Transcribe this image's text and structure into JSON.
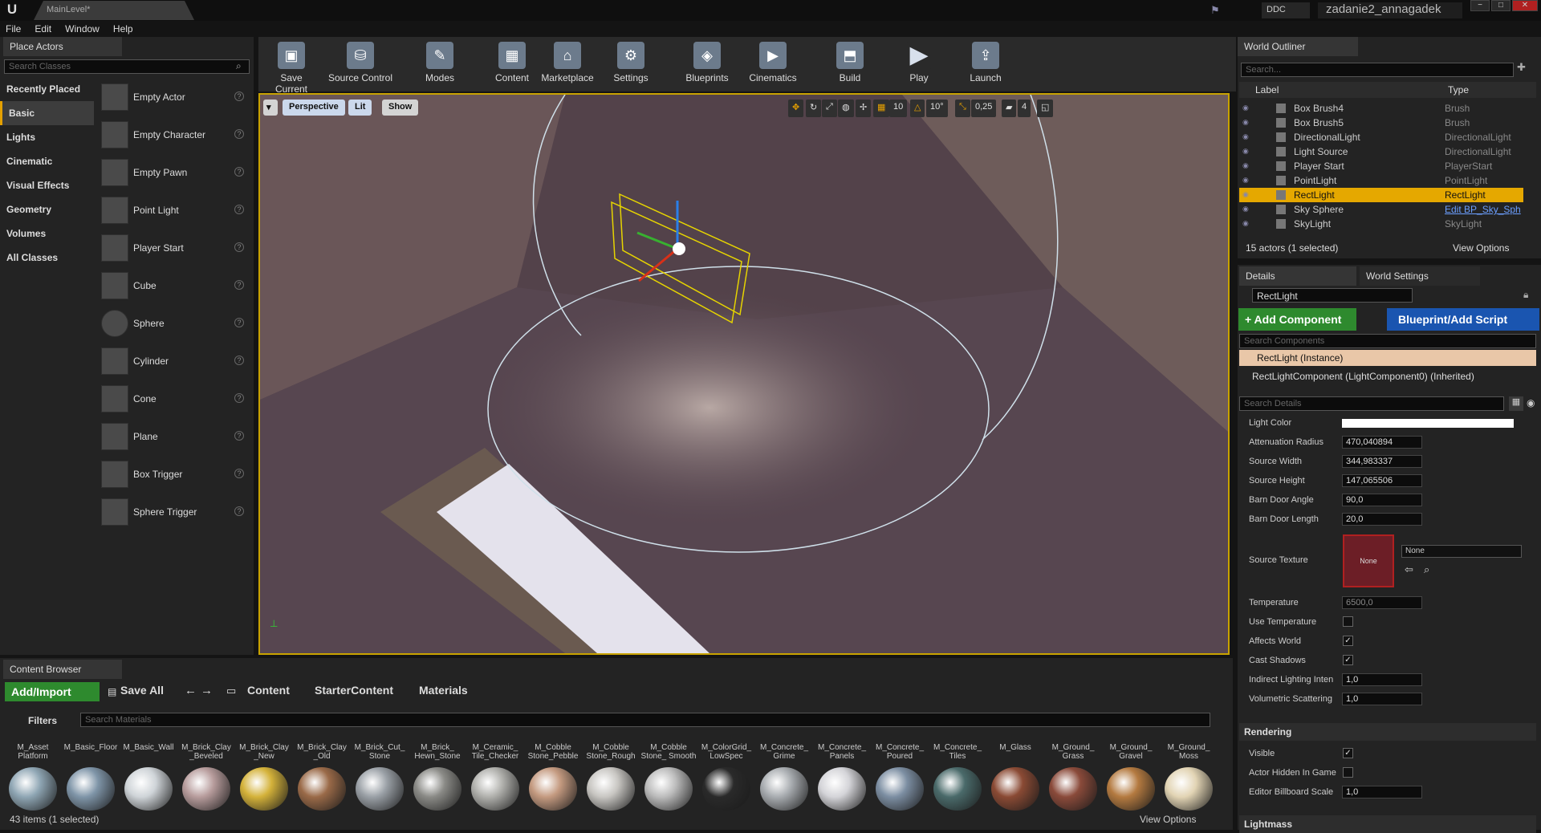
{
  "titlebar": {
    "logo": "U",
    "tab": "MainLevel*",
    "ddc": "DDC",
    "project": "zadanie2_annagadek",
    "min": "−",
    "max": "□",
    "close": "✕"
  },
  "menu": [
    "File",
    "Edit",
    "Window",
    "Help"
  ],
  "place_actors": {
    "tab": "Place Actors",
    "search_placeholder": "Search Classes",
    "categories": [
      "Recently Placed",
      "Basic",
      "Lights",
      "Cinematic",
      "Visual Effects",
      "Geometry",
      "Volumes",
      "All Classes"
    ],
    "selected_category": "Basic",
    "actors": [
      "Empty Actor",
      "Empty Character",
      "Empty Pawn",
      "Point Light",
      "Player Start",
      "Cube",
      "Sphere",
      "Cylinder",
      "Cone",
      "Plane",
      "Box Trigger",
      "Sphere Trigger"
    ]
  },
  "toolbar": {
    "buttons": [
      "Save Current",
      "Source Control",
      "Modes",
      "Content",
      "Marketplace",
      "Settings",
      "Blueprints",
      "Cinematics",
      "Build",
      "Play",
      "Launch"
    ],
    "icons": [
      "save-icon",
      "source-control-icon",
      "modes-icon",
      "content-icon",
      "marketplace-icon",
      "settings-icon",
      "blueprints-icon",
      "cinematics-icon",
      "build-icon",
      "play-icon",
      "launch-icon"
    ]
  },
  "viewport": {
    "perspective": "Perspective",
    "lit": "Lit",
    "show": "Show",
    "grid_snap": "10",
    "rot_snap": "10°",
    "scale_snap": "0,25",
    "cam_speed": "4"
  },
  "outliner": {
    "tab": "World Outliner",
    "search_placeholder": "Search...",
    "col_label": "Label",
    "col_type": "Type",
    "rows": [
      {
        "label": "Box Brush4",
        "type": "Brush"
      },
      {
        "label": "Box Brush5",
        "type": "Brush"
      },
      {
        "label": "DirectionalLight",
        "type": "DirectionalLight"
      },
      {
        "label": "Light Source",
        "type": "DirectionalLight"
      },
      {
        "label": "Player Start",
        "type": "PlayerStart"
      },
      {
        "label": "PointLight",
        "type": "PointLight"
      },
      {
        "label": "RectLight",
        "type": "RectLight"
      },
      {
        "label": "Sky Sphere",
        "type": "Edit BP_Sky_Sph"
      },
      {
        "label": "SkyLight",
        "type": "SkyLight"
      }
    ],
    "selected": "RectLight",
    "count": "15 actors (1 selected)",
    "view_options": "View Options"
  },
  "details": {
    "tab": "Details",
    "tab2": "World Settings",
    "name": "RectLight",
    "add_component": "+ Add Component",
    "blueprint": "Blueprint/Add Script",
    "comp_search": "Search Components",
    "instance": "RectLight (Instance)",
    "component": "RectLightComponent (LightComponent0) (Inherited)",
    "search_details": "Search Details",
    "props": {
      "light_color": "Light Color",
      "atten_label": "Attenuation Radius",
      "atten": "470,040894",
      "sw_label": "Source Width",
      "sw": "344,983337",
      "sh_label": "Source Height",
      "sh": "147,065506",
      "bda_label": "Barn Door Angle",
      "bda": "90,0",
      "bdl_label": "Barn Door Length",
      "bdl": "20,0",
      "tex_label": "Source Texture",
      "tex_thumb": "None",
      "tex_value": "None",
      "temp_label": "Temperature",
      "temp": "6500,0",
      "use_temp": "Use Temperature",
      "affects": "Affects World",
      "shadows": "Cast Shadows",
      "indirect_label": "Indirect Lighting Inten",
      "indirect": "1,0",
      "vol_label": "Volumetric Scattering",
      "vol": "1,0"
    },
    "rendering": {
      "title": "Rendering",
      "visible": "Visible",
      "hidden": "Actor Hidden In Game",
      "billboard_label": "Editor Billboard Scale",
      "billboard": "1,0"
    },
    "lightmass": "Lightmass"
  },
  "content_browser": {
    "tab": "Content Browser",
    "add_import": "Add/Import",
    "save_all": "Save All",
    "path": [
      "Content",
      "StarterContent",
      "Materials"
    ],
    "filters": "Filters",
    "search_placeholder": "Search Materials",
    "assets": [
      "M_Asset Platform",
      "M_Basic_Floor",
      "M_Basic_Wall",
      "M_Brick_Clay _Beveled",
      "M_Brick_Clay _New",
      "M_Brick_Clay _Old",
      "M_Brick_Cut_ Stone",
      "M_Brick_ Hewn_Stone",
      "M_Ceramic_ Tile_Checker",
      "M_Cobble Stone_Pebble",
      "M_Cobble Stone_Rough",
      "M_Cobble Stone_ Smooth",
      "M_ColorGrid_ LowSpec",
      "M_Concrete_ Grime",
      "M_Concrete_ Panels",
      "M_Concrete_ Poured",
      "M_Concrete_ Tiles",
      "M_Glass",
      "M_Ground_ Grass",
      "M_Ground_ Gravel",
      "M_Ground_ Moss"
    ],
    "colors": [
      "#8fa6b4",
      "#7f95a8",
      "#cfd4d8",
      "#b79c9c",
      "#d4b23a",
      "#9a6a48",
      "#9aa0a6",
      "#8a8a86",
      "#b0b0ac",
      "#c49a80",
      "#c8c6c2",
      "#bcbcbc",
      "#2a2a2a",
      "#a8acb0",
      "#d4d4d8",
      "#7c8ea2",
      "#4a6a6a",
      "#8a4a34",
      "#8a4a3a",
      "#b47a40",
      "#e2d4b4"
    ],
    "status": "43 items (1 selected)",
    "view_options": "View Options"
  }
}
